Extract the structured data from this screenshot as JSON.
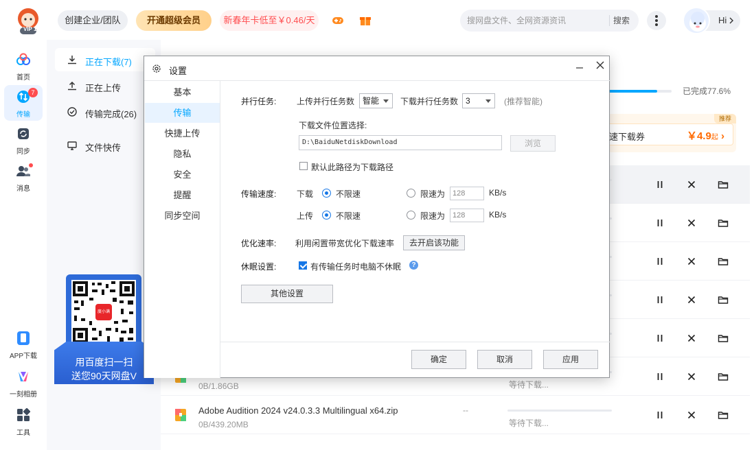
{
  "header": {
    "logo_text": "VIP 1",
    "team_btn": "创建企业/团队",
    "vip_btn": "开通超级会员",
    "promo_btn": "新春年卡低至￥0.46/天",
    "search_placeholder": "搜网盘文件、全网资源资讯",
    "search_btn": "搜索",
    "greeting": "Hi"
  },
  "rail": {
    "items": [
      {
        "label": "首页",
        "icon": "cloud-icon"
      },
      {
        "label": "传输",
        "icon": "transfer-icon",
        "badge": "7"
      },
      {
        "label": "同步",
        "icon": "sync-icon"
      },
      {
        "label": "消息",
        "icon": "message-icon"
      }
    ],
    "bottom": [
      {
        "label": "APP下载",
        "icon": "phone-icon"
      },
      {
        "label": "一刻相册",
        "icon": "album-icon"
      },
      {
        "label": "工具",
        "icon": "tools-icon"
      }
    ]
  },
  "subnav": {
    "items": [
      {
        "label": "正在下载(7)"
      },
      {
        "label": "正在上传"
      },
      {
        "label": "传输完成(26)"
      },
      {
        "label": "文件快传"
      }
    ],
    "qr_line1": "用百度扫一扫",
    "qr_line2": "送您90天网盘V",
    "qr_logo": "度小满"
  },
  "main": {
    "progress_text": "已完成77.6%",
    "progress_fraction": 0.776,
    "promo_tag": "推荐",
    "promo_label": "速下载券",
    "promo_price": "￥4.9",
    "promo_price_suffix": "起",
    "rows": [
      {
        "name": "",
        "size": "",
        "speed": "",
        "status": ""
      },
      {
        "name": "",
        "size": "",
        "speed": "",
        "status": ""
      },
      {
        "name": "",
        "size": "",
        "speed": "",
        "status": ""
      },
      {
        "name": "",
        "size": "",
        "speed": "",
        "status": ""
      },
      {
        "name": "",
        "size": "",
        "speed": "",
        "status": ""
      },
      {
        "name": "",
        "size": "0B/1.86GB",
        "speed": "",
        "status": "等待下载..."
      },
      {
        "name": "Adobe Audition 2024 v24.0.3.3 Multilingual x64.zip",
        "size": "0B/439.20MB",
        "speed": "--",
        "status": "等待下载..."
      }
    ]
  },
  "dialog": {
    "title": "设置",
    "tabs": [
      "基本",
      "传输",
      "快捷上传",
      "隐私",
      "安全",
      "提醒",
      "同步空间"
    ],
    "active_tab": "传输",
    "parallel_label": "并行任务:",
    "upload_parallel_label": "上传并行任务数",
    "upload_parallel_value": "智能",
    "download_parallel_label": "下载并行任务数",
    "download_parallel_value": "3",
    "recommend_hint": "(推荐智能)",
    "download_location_label": "下载文件位置选择:",
    "download_path": "D:\\BaiduNetdiskDownload",
    "browse_btn": "浏览",
    "default_path_label": "默认此路径为下载路径",
    "speed_label": "传输速度:",
    "download_label": "下载",
    "upload_label": "上传",
    "unlimited_label": "不限速",
    "limit_label": "限速为",
    "download_limit_value": "128",
    "upload_limit_value": "128",
    "unit": "KB/s",
    "optimize_label": "优化速率:",
    "optimize_desc": "利用闲置带宽优化下载速率",
    "optimize_btn": "去开启该功能",
    "sleep_label": "休眠设置:",
    "sleep_desc": "有传输任务时电脑不休眠",
    "help": "?",
    "other_btn": "其他设置",
    "ok_btn": "确定",
    "cancel_btn": "取消",
    "apply_btn": "应用"
  }
}
